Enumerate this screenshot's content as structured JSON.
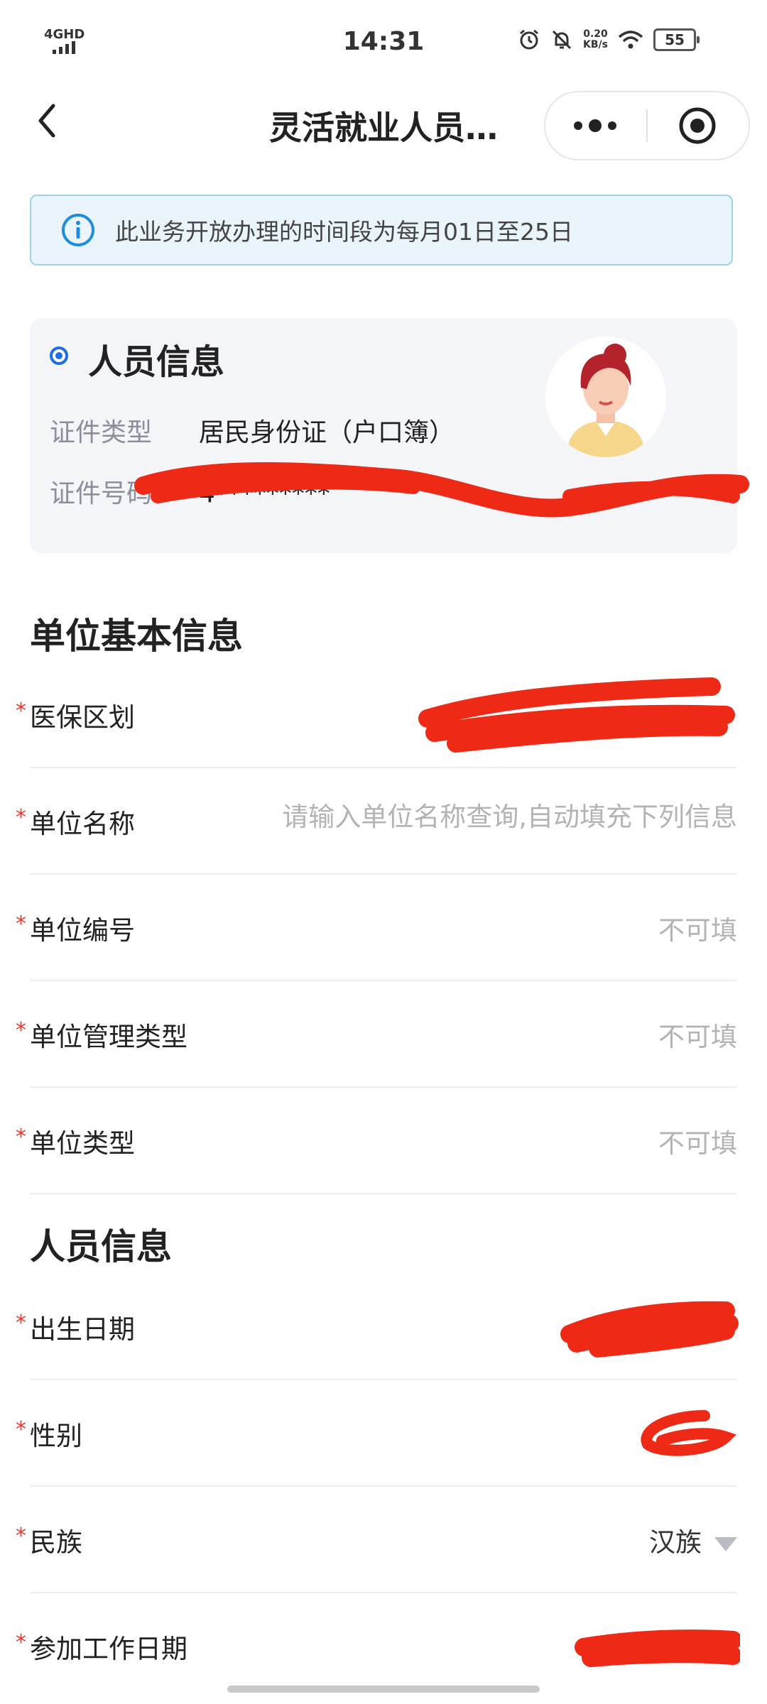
{
  "status_bar": {
    "network": "4GHD",
    "time": "14:31",
    "speed_value": "0.20",
    "speed_unit": "KB/s",
    "battery": "55"
  },
  "nav": {
    "title": "灵活就业人员…"
  },
  "notice": {
    "text": "此业务开放办理的时间段为每月01日至25日"
  },
  "person_card": {
    "title": "人员信息",
    "id_type_label": "证件类型",
    "id_type_value": "居民身份证（户口簿）",
    "id_number_label": "证件号码",
    "id_number_value": "4*********"
  },
  "unit_section": {
    "title": "单位基本信息",
    "fields": [
      {
        "label": "医保区划",
        "value": ""
      },
      {
        "label": "单位名称",
        "placeholder": "请输入单位名称查询,自动填充下列信息"
      },
      {
        "label": "单位编号",
        "value": "不可填"
      },
      {
        "label": "单位管理类型",
        "value": "不可填"
      },
      {
        "label": "单位类型",
        "value": "不可填"
      }
    ]
  },
  "person_section": {
    "title": "人员信息",
    "fields": [
      {
        "label": "出生日期",
        "value": ""
      },
      {
        "label": "性别",
        "value": ""
      },
      {
        "label": "民族",
        "value": "汉族"
      },
      {
        "label": "参加工作日期",
        "value": ""
      }
    ]
  },
  "required_mark": "*",
  "colors": {
    "accent": "#1e6fe6",
    "required": "#e83a2f",
    "redaction": "#ee2a17",
    "notice_bg": "#e9f4fb"
  }
}
